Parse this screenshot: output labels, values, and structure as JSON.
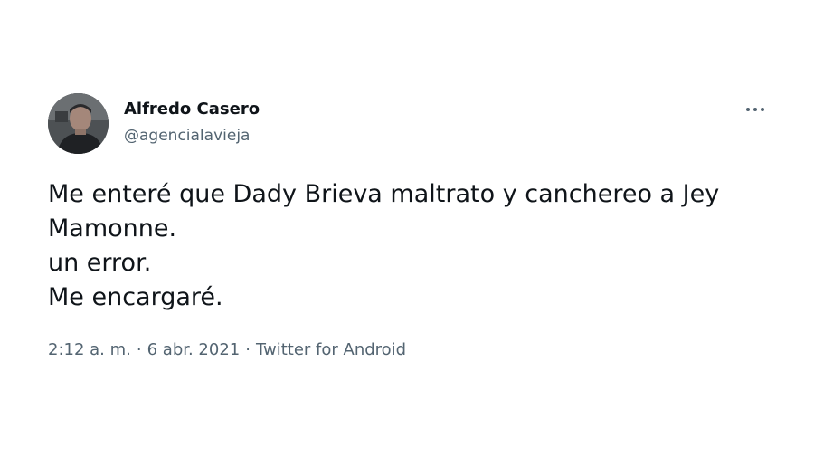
{
  "author": {
    "display_name": "Alfredo Casero",
    "handle": "@agencialavieja",
    "avatar_icon": "profile-photo"
  },
  "more_icon": "ellipsis-icon",
  "tweet": {
    "lines": [
      "Me enteré que Dady Brieva maltrato y canchereo a Jey",
      "Mamonne.",
      "un error.",
      "Me encargaré."
    ]
  },
  "meta": {
    "time": "2:12 a. m.",
    "separator": "·",
    "date": "6 abr. 2021",
    "source": "Twitter for Android"
  },
  "colors": {
    "text": "#0f1419",
    "secondary": "#536471",
    "background": "#ffffff"
  }
}
